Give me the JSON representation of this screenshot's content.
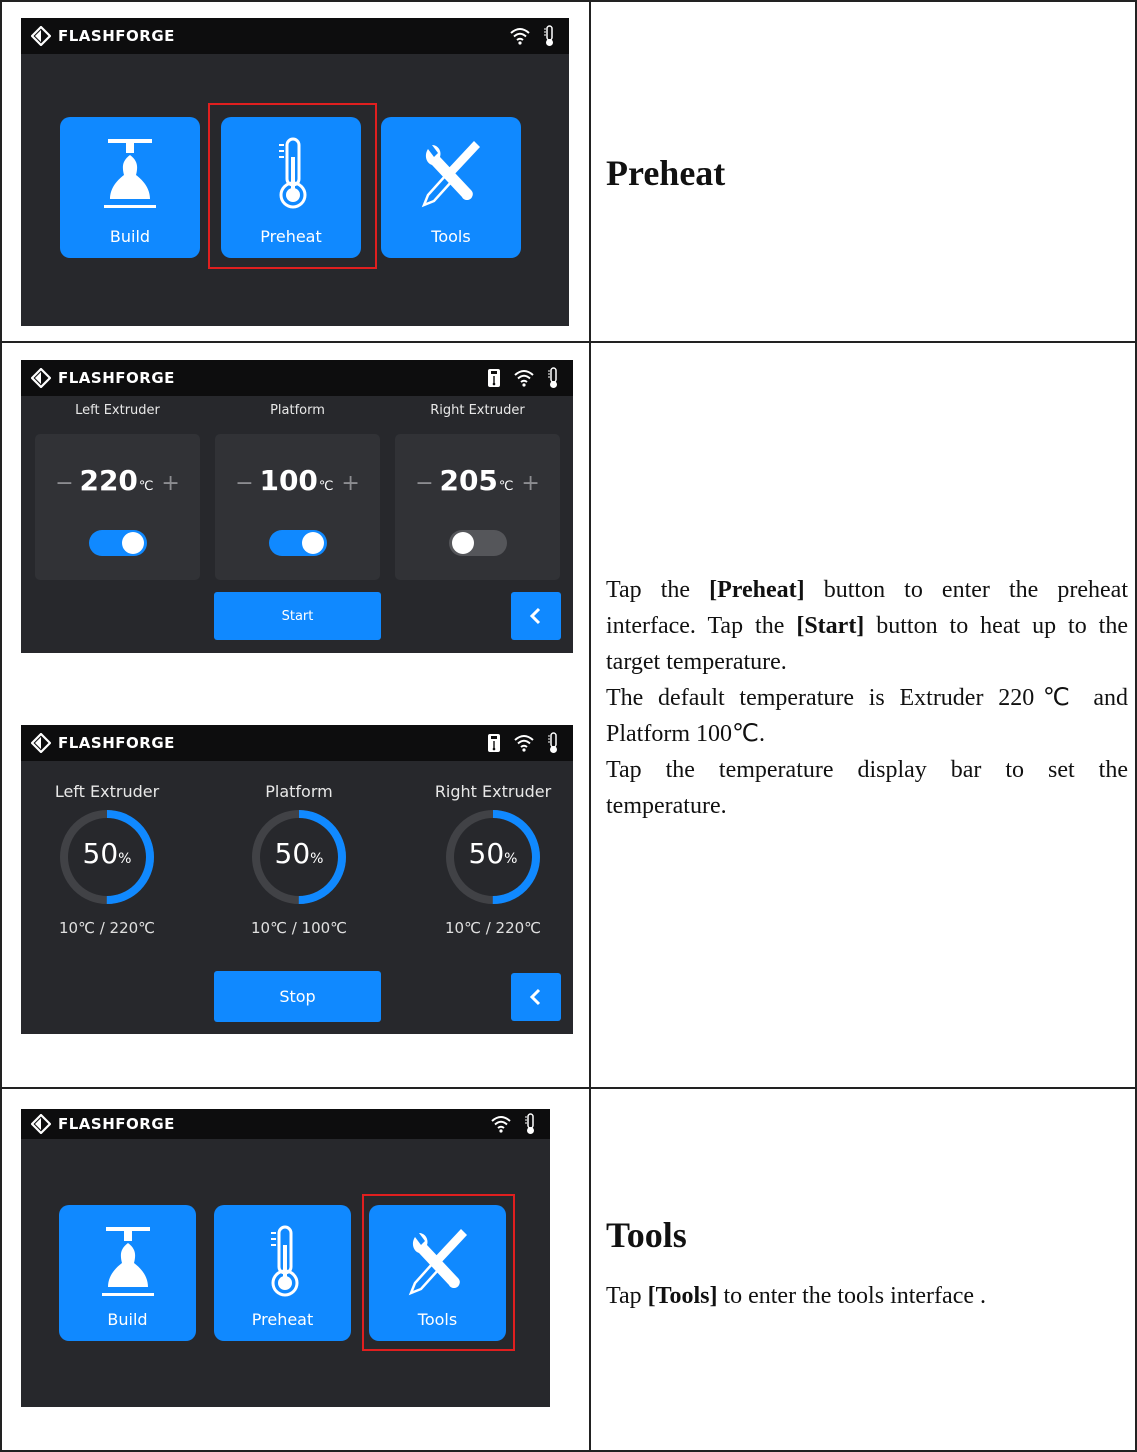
{
  "brand": {
    "name": "FLASHFORGE"
  },
  "colors": {
    "accent": "#1089ff",
    "screen_bg": "#27282c",
    "topbar_bg": "#0d0d0e",
    "highlight": "#e01f1f",
    "toggle_off": "#55565a"
  },
  "home_screen": {
    "tiles": [
      {
        "label": "Build",
        "icon": "build-icon"
      },
      {
        "label": "Preheat",
        "icon": "thermometer-icon"
      },
      {
        "label": "Tools",
        "icon": "tools-icon"
      }
    ]
  },
  "preheat_setup_screen": {
    "columns": [
      {
        "title": "Left Extruder",
        "value": "220",
        "unit": "℃",
        "enabled": true
      },
      {
        "title": "Platform",
        "value": "100",
        "unit": "℃",
        "enabled": true
      },
      {
        "title": "Right Extruder",
        "value": "205",
        "unit": "℃",
        "enabled": false
      }
    ],
    "minus": "−",
    "plus": "+",
    "start_label": "Start"
  },
  "preheat_progress_screen": {
    "columns": [
      {
        "title": "Left Extruder",
        "percent": "50",
        "percent_unit": "%",
        "progress": 0.5,
        "status": "10℃ / 220℃"
      },
      {
        "title": "Platform",
        "percent": "50",
        "percent_unit": "%",
        "progress": 0.5,
        "status": "10℃ /  100℃"
      },
      {
        "title": "Right Extruder",
        "percent": "50",
        "percent_unit": "%",
        "progress": 0.5,
        "status": "10℃ / 220℃"
      }
    ],
    "stop_label": "Stop"
  },
  "text": {
    "preheat_heading": "Preheat",
    "tools_heading": "Tools",
    "para1": {
      "t1": "Tap the ",
      "b1": "[Preheat]",
      "t2": " button to enter the preheat interface. Tap the ",
      "b2": "[Start]",
      "t3": " button to heat up to the target temperature."
    },
    "para2": "The default temperature is Extruder 220℃ and Platform 100℃.",
    "para3": "Tap the temperature display bar to set the temperature.",
    "tools_para": {
      "t1": "Tap ",
      "b1": "[Tools]",
      "t2": " to enter the tools interface ."
    }
  }
}
